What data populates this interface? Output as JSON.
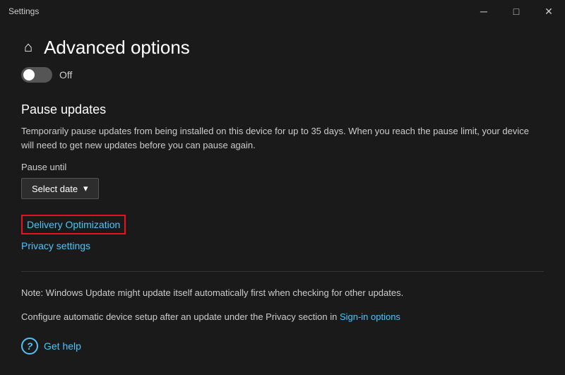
{
  "titlebar": {
    "title": "Settings",
    "minimize_label": "─",
    "maximize_label": "□",
    "close_label": "✕"
  },
  "page": {
    "back_icon": "←",
    "home_icon": "⌂",
    "title": "Advanced options",
    "toggle_state": "Off",
    "sections": {
      "pause_updates": {
        "title": "Pause updates",
        "description": "Temporarily pause updates from being installed on this device for up to 35 days. When you reach the pause limit, your device will need to get new updates before you can pause again.",
        "pause_until_label": "Pause until",
        "date_select_label": "Select date",
        "date_select_chevron": "▾"
      },
      "links": {
        "delivery_optimization": "Delivery Optimization",
        "privacy_settings": "Privacy settings"
      },
      "notes": {
        "note1": "Note: Windows Update might update itself automatically first when checking for other updates.",
        "note2_prefix": "Configure automatic device setup after an update under the Privacy section in ",
        "note2_link": "Sign-in options",
        "note2_suffix": ""
      },
      "help": {
        "icon": "?",
        "label": "Get help"
      }
    }
  }
}
